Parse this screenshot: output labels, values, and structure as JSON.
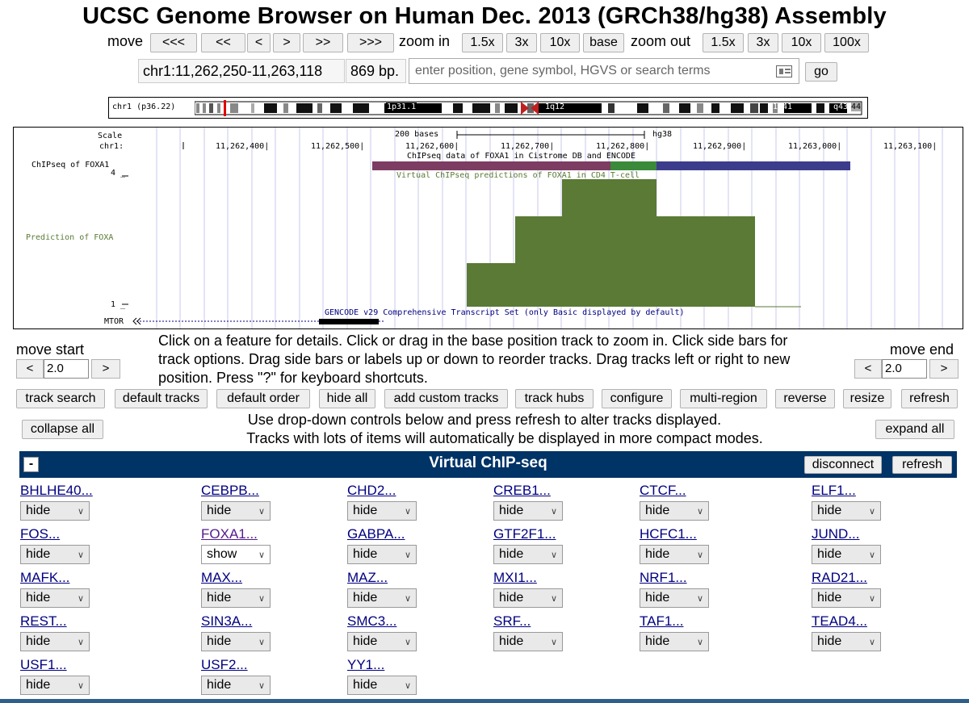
{
  "title": "UCSC Genome Browser on Human Dec. 2013 (GRCh38/hg38) Assembly",
  "nav": {
    "move_label": "move",
    "move_buttons": [
      "<<<",
      "<<",
      "<",
      ">",
      ">>",
      ">>>"
    ],
    "zoom_in_label": "zoom in",
    "zoom_in_buttons": [
      "1.5x",
      "3x",
      "10x",
      "base"
    ],
    "zoom_out_label": "zoom out",
    "zoom_out_buttons": [
      "1.5x",
      "3x",
      "10x",
      "100x"
    ]
  },
  "position": {
    "coords": "chr1:11,262,250-11,263,118",
    "size": "869 bp.",
    "search_placeholder": "enter position, gene symbol, HGVS or search terms",
    "go_label": "go"
  },
  "ideogram": {
    "chrom_label": "chr1 (p36.22)",
    "bands": [
      "1p31.1",
      "1q12",
      "1q41",
      "q43",
      "44"
    ]
  },
  "tracks_image": {
    "scale_label": "Scale",
    "chrom_label": "chr1:",
    "ruler_text": "200 bases",
    "assembly": "hg38",
    "positions": [
      "11,262,400|",
      "11,262,500|",
      "11,262,600|",
      "11,262,700|",
      "11,262,800|",
      "11,262,900|",
      "11,263,000|",
      "11,263,100|"
    ],
    "chipseq_label": "ChIPseq of FOXA1",
    "chipseq_desc": "ChIPseq data of FOXA1 in Cistrome DB and ENCODE",
    "axis_max": "4 _",
    "virtual_desc": "Virtual ChIPseq predictions of FOXA1 in CD4 T-cell",
    "prediction_label": "Prediction of FOXA",
    "axis_min": "1 _",
    "gencode_desc": "GENCODE v29 Comprehensive Transcript Set (only Basic displayed by default)",
    "gene_label": "MTOR"
  },
  "controls": {
    "move_start_label": "move start",
    "move_start_value": "2.0",
    "move_end_label": "move end",
    "move_end_value": "2.0",
    "left_arrow": "<",
    "right_arrow": ">",
    "help_text": "Click on a feature for details. Click or drag in the base position track to zoom in. Click side bars for track options. Drag side bars or labels up or down to reorder tracks. Drag tracks left or right to new position. Press \"?\" for keyboard shortcuts."
  },
  "toolbar": [
    "track search",
    "default tracks",
    "default order",
    "hide all",
    "add custom tracks",
    "track hubs",
    "configure",
    "multi-region",
    "reverse",
    "resize",
    "refresh"
  ],
  "dropdown_info": {
    "collapse_all": "collapse all",
    "expand_all": "expand all",
    "line1": "Use drop-down controls below and press refresh to alter tracks displayed.",
    "line2": "Tracks with lots of items will automatically be displayed in more compact modes."
  },
  "group": {
    "title": "Virtual ChIP-seq",
    "collapse_symbol": "-",
    "disconnect_label": "disconnect",
    "refresh_label": "refresh"
  },
  "tracks": [
    {
      "name": "BHLHE40...",
      "mode": "hide"
    },
    {
      "name": "CEBPB...",
      "mode": "hide"
    },
    {
      "name": "CHD2...",
      "mode": "hide"
    },
    {
      "name": "CREB1...",
      "mode": "hide"
    },
    {
      "name": "CTCF...",
      "mode": "hide"
    },
    {
      "name": "ELF1...",
      "mode": "hide"
    },
    {
      "name": "FOS...",
      "mode": "hide"
    },
    {
      "name": "FOXA1...",
      "mode": "show"
    },
    {
      "name": "GABPA...",
      "mode": "hide"
    },
    {
      "name": "GTF2F1...",
      "mode": "hide"
    },
    {
      "name": "HCFC1...",
      "mode": "hide"
    },
    {
      "name": "JUND...",
      "mode": "hide"
    },
    {
      "name": "MAFK...",
      "mode": "hide"
    },
    {
      "name": "MAX...",
      "mode": "hide"
    },
    {
      "name": "MAZ...",
      "mode": "hide"
    },
    {
      "name": "MXI1...",
      "mode": "hide"
    },
    {
      "name": "NRF1...",
      "mode": "hide"
    },
    {
      "name": "RAD21...",
      "mode": "hide"
    },
    {
      "name": "REST...",
      "mode": "hide"
    },
    {
      "name": "SIN3A...",
      "mode": "hide"
    },
    {
      "name": "SMC3...",
      "mode": "hide"
    },
    {
      "name": "SRF...",
      "mode": "hide"
    },
    {
      "name": "TAF1...",
      "mode": "hide"
    },
    {
      "name": "TEAD4...",
      "mode": "hide"
    },
    {
      "name": "USF1...",
      "mode": "hide"
    },
    {
      "name": "USF2...",
      "mode": "hide"
    },
    {
      "name": "YY1...",
      "mode": "hide"
    }
  ],
  "colors": {
    "group_bar": "#003366",
    "prediction_fill": "#5a7a35",
    "chipseq_bar_a": "#7d3c62",
    "chipseq_bar_b": "#3a8a3a",
    "chipseq_bar_c": "#3c3c8c",
    "link": "#000080"
  }
}
